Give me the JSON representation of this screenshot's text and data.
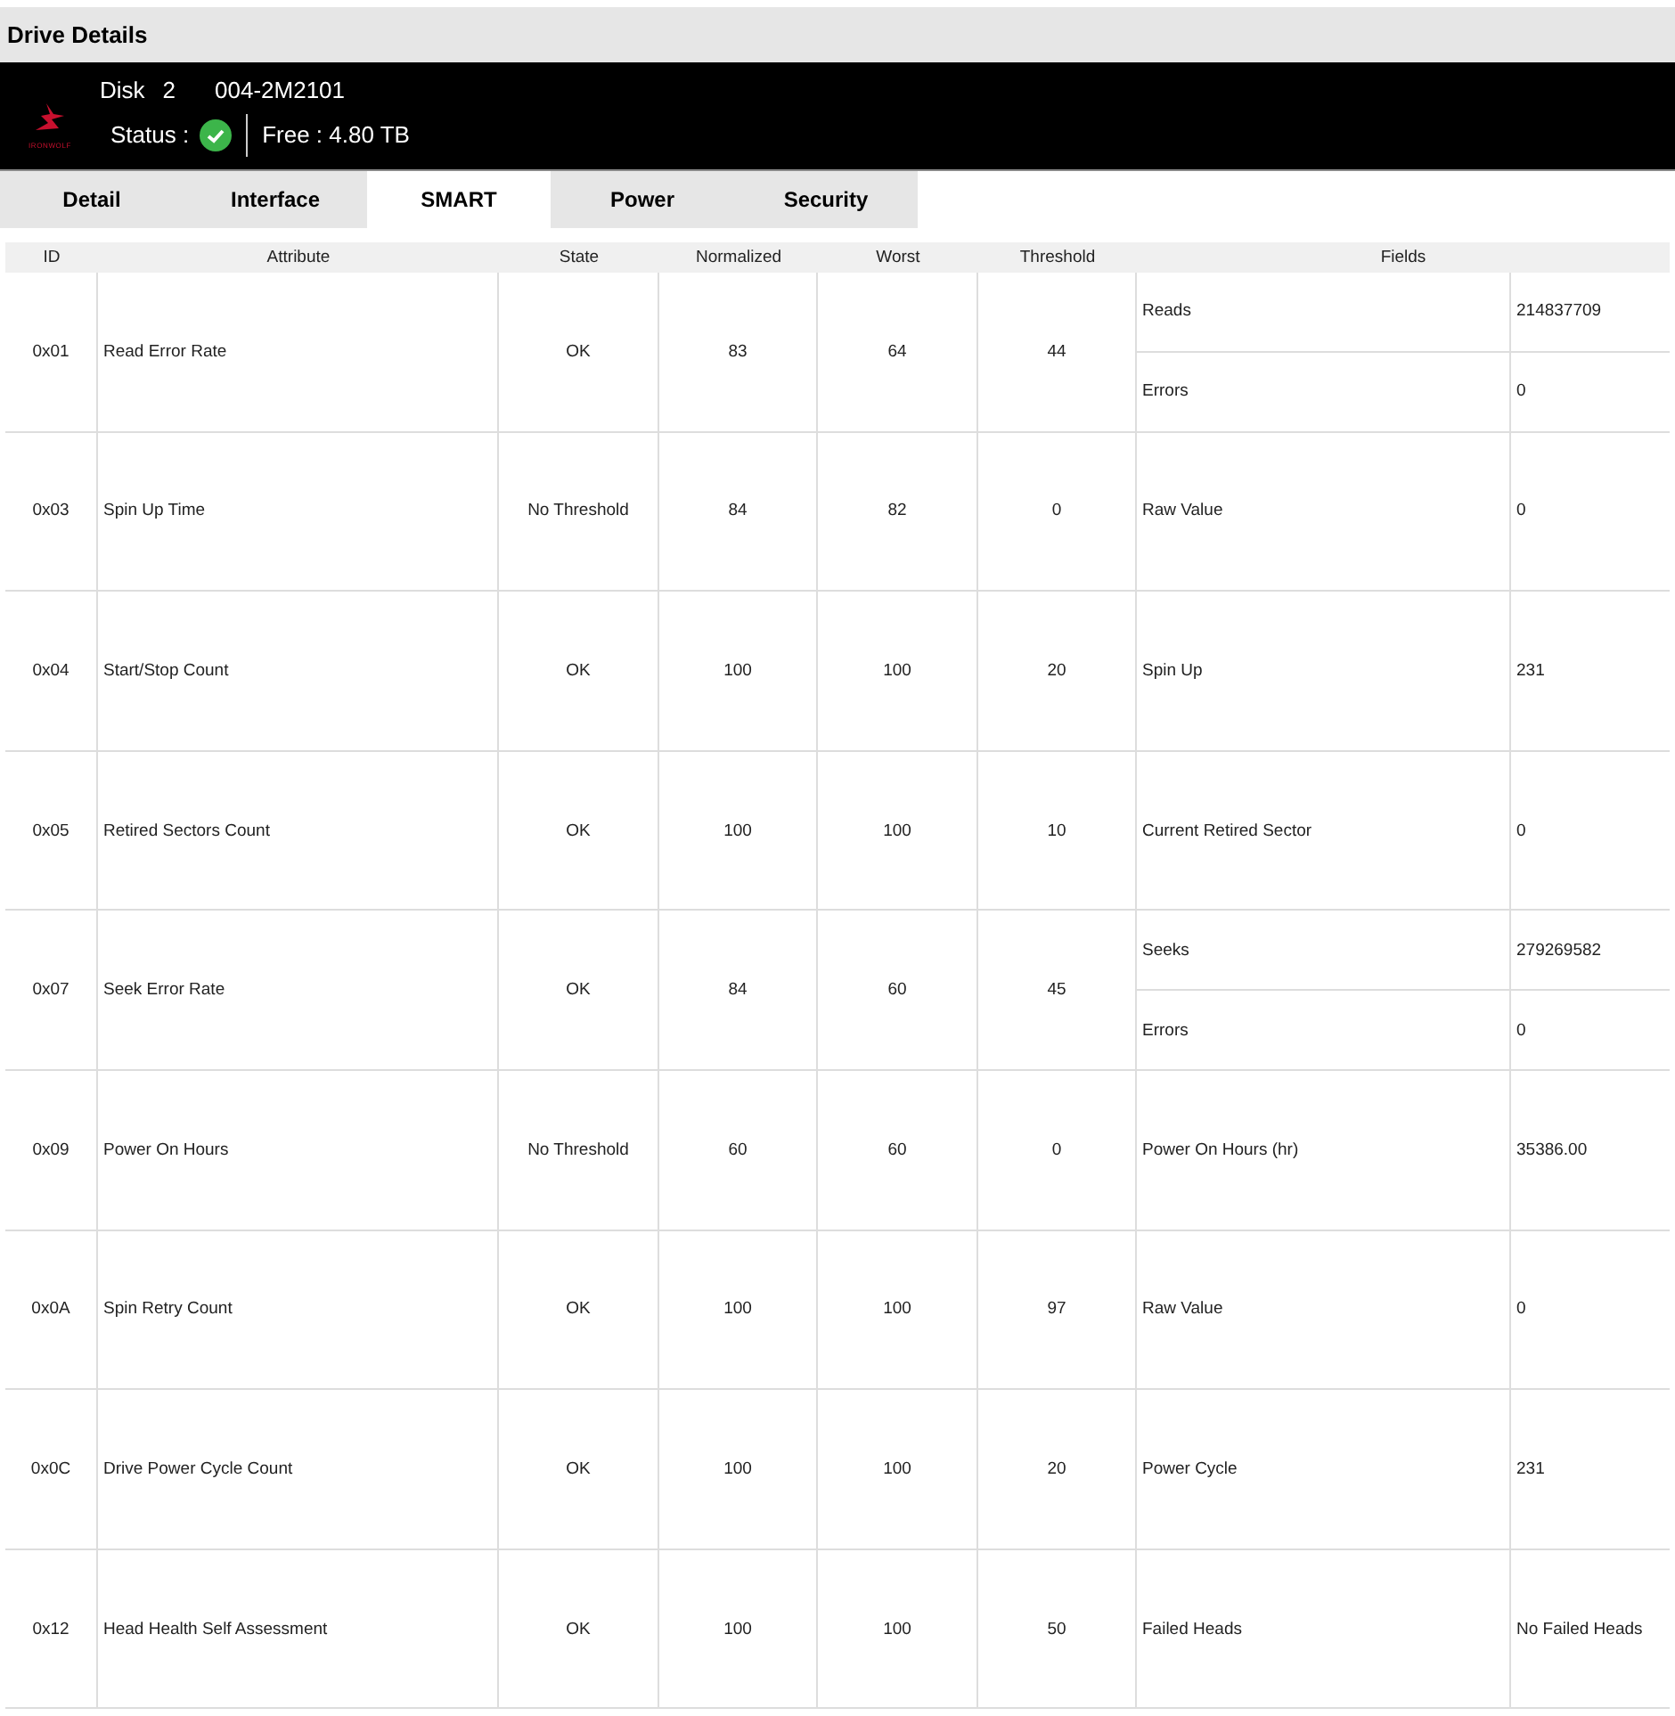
{
  "window": {
    "title": "Drive Details"
  },
  "drive": {
    "logo_text": "IRONWOLF",
    "disk_label": "Disk",
    "disk_number": "2",
    "model": "004-2M2101",
    "status_label": "Status :",
    "status_ok": true,
    "free": "Free : 4.80 TB"
  },
  "tabs": [
    {
      "label": "Detail",
      "selected": false
    },
    {
      "label": "Interface",
      "selected": false
    },
    {
      "label": "SMART",
      "selected": true
    },
    {
      "label": "Power",
      "selected": false
    },
    {
      "label": "Security",
      "selected": false
    }
  ],
  "table": {
    "columns": [
      "ID",
      "Attribute",
      "State",
      "Normalized",
      "Worst",
      "Threshold",
      "Fields"
    ],
    "rows": [
      {
        "id": "0x01",
        "attribute": "Read Error Rate",
        "state": "OK",
        "normalized": "83",
        "worst": "64",
        "threshold": "44",
        "fields": [
          {
            "name": "Reads",
            "value": "214837709"
          },
          {
            "name": "Errors",
            "value": "0"
          }
        ]
      },
      {
        "id": "0x03",
        "attribute": "Spin Up Time",
        "state": "No Threshold",
        "normalized": "84",
        "worst": "82",
        "threshold": "0",
        "fields": [
          {
            "name": "Raw Value",
            "value": "0"
          }
        ]
      },
      {
        "id": "0x04",
        "attribute": "Start/Stop Count",
        "state": "OK",
        "normalized": "100",
        "worst": "100",
        "threshold": "20",
        "fields": [
          {
            "name": "Spin Up",
            "value": "231"
          }
        ]
      },
      {
        "id": "0x05",
        "attribute": "Retired Sectors Count",
        "state": "OK",
        "normalized": "100",
        "worst": "100",
        "threshold": "10",
        "fields": [
          {
            "name": "Current Retired Sector",
            "value": "0"
          }
        ]
      },
      {
        "id": "0x07",
        "attribute": "Seek Error Rate",
        "state": "OK",
        "normalized": "84",
        "worst": "60",
        "threshold": "45",
        "fields": [
          {
            "name": "Seeks",
            "value": "279269582"
          },
          {
            "name": "Errors",
            "value": "0"
          }
        ]
      },
      {
        "id": "0x09",
        "attribute": "Power On Hours",
        "state": "No Threshold",
        "normalized": "60",
        "worst": "60",
        "threshold": "0",
        "fields": [
          {
            "name": "Power On Hours (hr)",
            "value": "35386.00"
          }
        ]
      },
      {
        "id": "0x0A",
        "attribute": "Spin Retry Count",
        "state": "OK",
        "normalized": "100",
        "worst": "100",
        "threshold": "97",
        "fields": [
          {
            "name": "Raw Value",
            "value": "0"
          }
        ]
      },
      {
        "id": "0x0C",
        "attribute": "Drive Power Cycle Count",
        "state": "OK",
        "normalized": "100",
        "worst": "100",
        "threshold": "20",
        "fields": [
          {
            "name": "Power Cycle",
            "value": "231"
          }
        ]
      },
      {
        "id": "0x12",
        "attribute": "Head Health Self Assessment",
        "state": "OK",
        "normalized": "100",
        "worst": "100",
        "threshold": "50",
        "fields": [
          {
            "name": "Failed Heads",
            "value": "No Failed Heads"
          }
        ]
      }
    ]
  }
}
